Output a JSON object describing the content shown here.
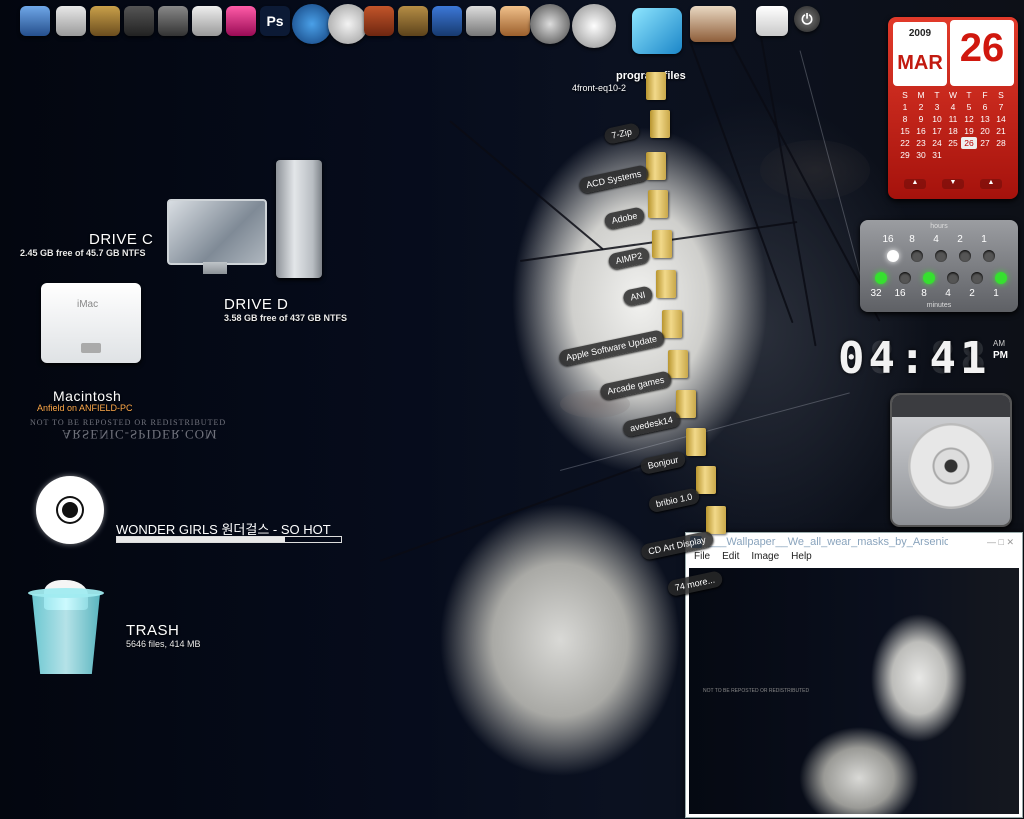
{
  "dock": {
    "icons": [
      "monitor-icon",
      "computer-icon",
      "printer-icon",
      "gallery-icon",
      "tv-icon",
      "speaker-icon",
      "ipod-icon",
      "media-player-icon",
      "photoshop-icon",
      "safari-icon",
      "wikipedia-icon",
      "fox-icon",
      "photo-icon",
      "itunes-icon",
      "camera-icon",
      "tool-icon",
      "music-icon"
    ],
    "photoshop_label": "Ps"
  },
  "drives": {
    "c": {
      "name": "DRIVE C",
      "info": "2.45 GB free of 45.7 GB NTFS"
    },
    "d": {
      "name": "DRIVE D",
      "info": "3.58 GB  free of 437 GB NTFS"
    },
    "mac": {
      "name": "Macintosh",
      "info": "Anfield on ANFIELD-PC",
      "imac_label": "iMac"
    }
  },
  "watermark": {
    "line1": "NOT TO BE REPOSTED OR REDISTRIBUTED",
    "line2": "ARSENIC-SPIDER.COM"
  },
  "now_playing": {
    "title": "WONDER GIRLS 원더걸스  - SO HOT",
    "progress": 0.75
  },
  "trash": {
    "name": "TRASH",
    "info": "5646 files, 414 MB"
  },
  "stack": {
    "title": "program files",
    "items": [
      "4front-eq10-2",
      "7-Zip",
      "ACD Systems",
      "Adobe",
      "AIMP2",
      "ANI",
      "Apple Software Update",
      "Arcade games",
      "avedesk14",
      "Bonjour",
      "bribio 1.0",
      "CD Art Display",
      "74 more..."
    ]
  },
  "calendar": {
    "year": "2009",
    "month": "MAR",
    "day": "26",
    "weekdays": [
      "S",
      "M",
      "T",
      "W",
      "T",
      "F",
      "S"
    ],
    "weeks": [
      [
        "1",
        "2",
        "3",
        "4",
        "5",
        "6",
        "7"
      ],
      [
        "8",
        "9",
        "10",
        "11",
        "12",
        "13",
        "14"
      ],
      [
        "15",
        "16",
        "17",
        "18",
        "19",
        "20",
        "21"
      ],
      [
        "22",
        "23",
        "24",
        "25",
        "26",
        "27",
        "28"
      ],
      [
        "29",
        "30",
        "31",
        "",
        "",
        "",
        ""
      ]
    ],
    "today": "26",
    "nav": [
      "▲",
      "▼",
      "▲"
    ]
  },
  "binary_clock": {
    "hours_label": "hours",
    "minutes_label": "minutes",
    "hour_bits": [
      "16",
      "8",
      "4",
      "2",
      "1"
    ],
    "hour_on": [
      true,
      false,
      false,
      false,
      false
    ],
    "minute_bits": [
      "32",
      "16",
      "8",
      "4",
      "2",
      "1"
    ],
    "minute_on": [
      true,
      false,
      true,
      false,
      false,
      true
    ]
  },
  "digital_clock": {
    "time": "04:41",
    "ghost": "88:88",
    "am": "AM",
    "pm": "PM"
  },
  "viewer": {
    "title": "___Wallpaper__We_all_wear_masks_by_Arsenic_Spider...",
    "controls": "—   □   ✕",
    "menu": [
      "File",
      "Edit",
      "Image",
      "Help"
    ],
    "watermark": "NOT TO BE REPOSTED OR REDISTRIBUTED"
  }
}
